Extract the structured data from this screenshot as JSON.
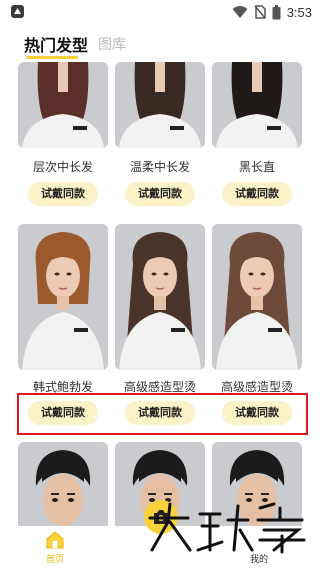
{
  "status_bar": {
    "time": "3:53"
  },
  "tabs": [
    {
      "label": "热门发型",
      "active": true
    },
    {
      "label": "图库",
      "active": false
    }
  ],
  "rows": [
    {
      "items": [
        {
          "title": "层次中长发",
          "button": "试戴同款",
          "hair_color": "#5a2f2a"
        },
        {
          "title": "温柔中长发",
          "button": "试戴同款",
          "hair_color": "#3a2a24"
        },
        {
          "title": "黑长直",
          "button": "试戴同款",
          "hair_color": "#1f1a18"
        }
      ]
    },
    {
      "items": [
        {
          "title": "韩式鲍勃发",
          "button": "试戴同款",
          "hair_color": "#9a5a2e"
        },
        {
          "title": "高级感造型烫",
          "button": "试戴同款",
          "hair_color": "#4a342a"
        },
        {
          "title": "高级感造型烫",
          "button": "试戴同款",
          "hair_color": "#6e4a3a"
        }
      ]
    },
    {
      "items": [
        {
          "hair_color": "#1c1a1a"
        },
        {
          "hair_color": "#1c1a1a"
        },
        {
          "hair_color": "#1c1a1a"
        }
      ]
    }
  ],
  "bottom_nav": {
    "home_label": "首页",
    "mine_label": "我的"
  },
  "accent": "#f7d23b",
  "highlight_color": "#e0191e",
  "watermark": "大玩家"
}
